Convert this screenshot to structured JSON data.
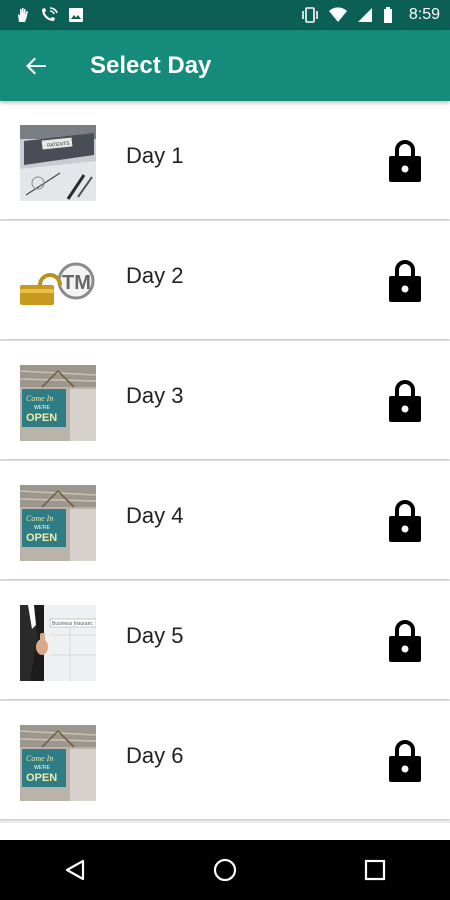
{
  "status_bar": {
    "time": "8:59",
    "left_icons": [
      "hand-icon",
      "wifi-call-icon",
      "image-icon"
    ],
    "right_icons": [
      "vibrate-icon",
      "wifi-icon",
      "signal-icon",
      "battery-icon"
    ]
  },
  "app_bar": {
    "title": "Select Day",
    "back_icon": "arrow-back-icon",
    "color": "#158b7c"
  },
  "days": [
    {
      "label": "Day 1",
      "thumbnail": "patents-folder-image",
      "locked": true
    },
    {
      "label": "Day 2",
      "thumbnail": "trademark-lock-image",
      "locked": true
    },
    {
      "label": "Day 3",
      "thumbnail": "open-sign-image",
      "locked": true
    },
    {
      "label": "Day 4",
      "thumbnail": "open-sign-image",
      "locked": true
    },
    {
      "label": "Day 5",
      "thumbnail": "businessman-image",
      "locked": true
    },
    {
      "label": "Day 6",
      "thumbnail": "open-sign-image",
      "locked": true
    }
  ],
  "nav_bar": {
    "icons": [
      "back-triangle-icon",
      "home-circle-icon",
      "recents-square-icon"
    ]
  }
}
